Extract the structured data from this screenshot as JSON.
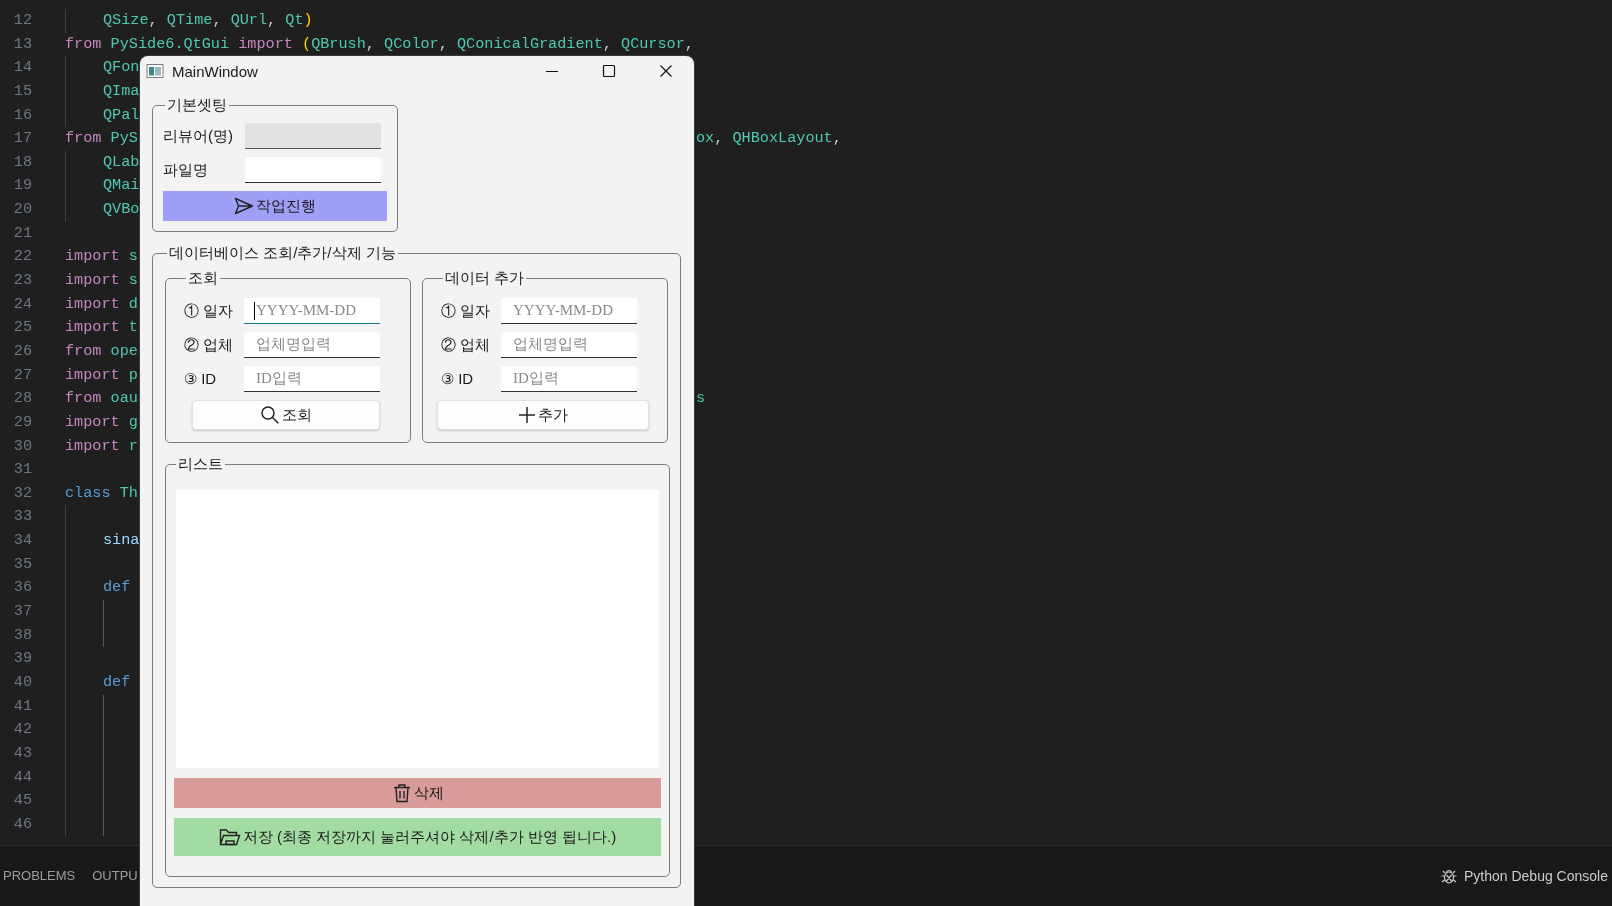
{
  "editor": {
    "lines": [
      {
        "number": "12",
        "indented": true,
        "tokens": [
          {
            "text": "QSize",
            "kind": "type"
          },
          {
            "text": ", ",
            "kind": "plain"
          },
          {
            "text": "QTime",
            "kind": "type"
          },
          {
            "text": ", ",
            "kind": "plain"
          },
          {
            "text": "QUrl",
            "kind": "type"
          },
          {
            "text": ", ",
            "kind": "plain"
          },
          {
            "text": "Qt",
            "kind": "type"
          },
          {
            "text": ")",
            "kind": "bracket"
          }
        ]
      },
      {
        "number": "13",
        "tokens": [
          {
            "text": "from",
            "kind": "keyword"
          },
          {
            "text": " PySide6.QtGui",
            "kind": "type"
          },
          {
            "text": " import",
            "kind": "keyword"
          },
          {
            "text": " (",
            "kind": "bracket"
          },
          {
            "text": "QBrush",
            "kind": "type"
          },
          {
            "text": ", ",
            "kind": "plain"
          },
          {
            "text": "QColor",
            "kind": "type"
          },
          {
            "text": ", ",
            "kind": "plain"
          },
          {
            "text": "QConicalGradient",
            "kind": "type"
          },
          {
            "text": ", ",
            "kind": "plain"
          },
          {
            "text": "QCursor",
            "kind": "type"
          },
          {
            "text": ",",
            "kind": "plain"
          }
        ]
      },
      {
        "number": "14",
        "indented": true,
        "tokens": [
          {
            "text": "QFon",
            "kind": "type"
          }
        ]
      },
      {
        "number": "15",
        "indented": true,
        "tokens": [
          {
            "text": "QIma",
            "kind": "type"
          }
        ]
      },
      {
        "number": "16",
        "indented": true,
        "tokens": [
          {
            "text": "QPal",
            "kind": "type"
          }
        ]
      },
      {
        "number": "17",
        "tokens": [
          {
            "text": "from",
            "kind": "keyword"
          },
          {
            "text": " PyS",
            "kind": "type"
          }
        ],
        "right_tokens": [
          {
            "text": "ox",
            "kind": "type"
          },
          {
            "text": ", ",
            "kind": "plain"
          },
          {
            "text": "QHBoxLayout",
            "kind": "type"
          },
          {
            "text": ",",
            "kind": "plain"
          }
        ]
      },
      {
        "number": "18",
        "indented": true,
        "tokens": [
          {
            "text": "QLab",
            "kind": "type"
          }
        ]
      },
      {
        "number": "19",
        "indented": true,
        "tokens": [
          {
            "text": "QMai",
            "kind": "type"
          }
        ]
      },
      {
        "number": "20",
        "indented": true,
        "tokens": [
          {
            "text": "QVBo",
            "kind": "type"
          }
        ]
      },
      {
        "number": "21"
      },
      {
        "number": "22",
        "tokens": [
          {
            "text": "import",
            "kind": "keyword"
          },
          {
            "text": " s",
            "kind": "type"
          }
        ]
      },
      {
        "number": "23",
        "tokens": [
          {
            "text": "import",
            "kind": "keyword"
          },
          {
            "text": " s",
            "kind": "type"
          }
        ]
      },
      {
        "number": "24",
        "tokens": [
          {
            "text": "import",
            "kind": "keyword"
          },
          {
            "text": " d",
            "kind": "type"
          }
        ]
      },
      {
        "number": "25",
        "tokens": [
          {
            "text": "import",
            "kind": "keyword"
          },
          {
            "text": " t",
            "kind": "type"
          }
        ]
      },
      {
        "number": "26",
        "tokens": [
          {
            "text": "from",
            "kind": "keyword"
          },
          {
            "text": " ope",
            "kind": "type"
          }
        ]
      },
      {
        "number": "27",
        "tokens": [
          {
            "text": "import",
            "kind": "keyword"
          },
          {
            "text": " p",
            "kind": "type"
          }
        ]
      },
      {
        "number": "28",
        "tokens": [
          {
            "text": "from",
            "kind": "keyword"
          },
          {
            "text": " oau",
            "kind": "type"
          }
        ],
        "right_tokens": [
          {
            "text": "s",
            "kind": "type"
          }
        ]
      },
      {
        "number": "29",
        "tokens": [
          {
            "text": "import",
            "kind": "keyword"
          },
          {
            "text": " g",
            "kind": "type"
          }
        ]
      },
      {
        "number": "30",
        "tokens": [
          {
            "text": "import",
            "kind": "keyword"
          },
          {
            "text": " r",
            "kind": "type"
          }
        ]
      },
      {
        "number": "31"
      },
      {
        "number": "32",
        "tokens": [
          {
            "text": "class",
            "kind": "storage"
          },
          {
            "text": " Th",
            "kind": "type"
          }
        ]
      },
      {
        "number": "33",
        "indented": true
      },
      {
        "number": "34",
        "indented": true,
        "tokens": [
          {
            "text": "sina",
            "kind": "variable"
          }
        ]
      },
      {
        "number": "35",
        "indented": true
      },
      {
        "number": "36",
        "indented": true,
        "tokens": [
          {
            "text": "def",
            "kind": "storage"
          }
        ]
      },
      {
        "number": "37",
        "indented": true,
        "nested": true
      },
      {
        "number": "38",
        "indented": true,
        "nested": true
      },
      {
        "number": "39",
        "indented": true
      },
      {
        "number": "40",
        "indented": true,
        "tokens": [
          {
            "text": "def",
            "kind": "storage"
          }
        ]
      },
      {
        "number": "41",
        "indented": true,
        "nested": true
      },
      {
        "number": "42",
        "indented": true,
        "nested": true
      },
      {
        "number": "43",
        "indented": true,
        "nested": true
      },
      {
        "number": "44",
        "indented": true,
        "nested": true
      },
      {
        "number": "45",
        "indented": true,
        "nested": true
      },
      {
        "number": "46",
        "indented": true,
        "nested": true
      }
    ]
  },
  "panel": {
    "tabs": [
      {
        "label": "PROBLEMS",
        "selected": false
      },
      {
        "label": "OUTPU",
        "selected": false
      }
    ],
    "status": "Python Debug Console"
  },
  "window": {
    "title": "MainWindow",
    "basic_settings": {
      "title": "기본셋팅",
      "fields": [
        {
          "label": "리뷰어(명)",
          "disabled": true
        },
        {
          "label": "파일명",
          "disabled": false
        }
      ],
      "button": "작업진행"
    },
    "database": {
      "title": "데이터베이스 조회/추가/삭제 기능",
      "query": {
        "title": "조회",
        "fields": [
          {
            "label": "① 일자",
            "placeholder": "YYYY-MM-DD",
            "focused": true
          },
          {
            "label": "② 업체",
            "placeholder": "업체명입력",
            "focused": false
          },
          {
            "label": "③ ID",
            "placeholder": "ID입력",
            "focused": false
          }
        ],
        "button": "조회"
      },
      "add": {
        "title": "데이터 추가",
        "fields": [
          {
            "label": "① 일자",
            "placeholder": "YYYY-MM-DD",
            "focused": false
          },
          {
            "label": "② 업체",
            "placeholder": "업체명입력",
            "focused": false
          },
          {
            "label": "③ ID",
            "placeholder": "ID입력",
            "focused": false
          }
        ],
        "button": "추가"
      },
      "list": {
        "title": "리스트",
        "delete_button": "삭제",
        "save_button": "저장 (최종 저장까지 눌러주셔야 삭제/추가 반영 됩니다.)"
      }
    }
  }
}
